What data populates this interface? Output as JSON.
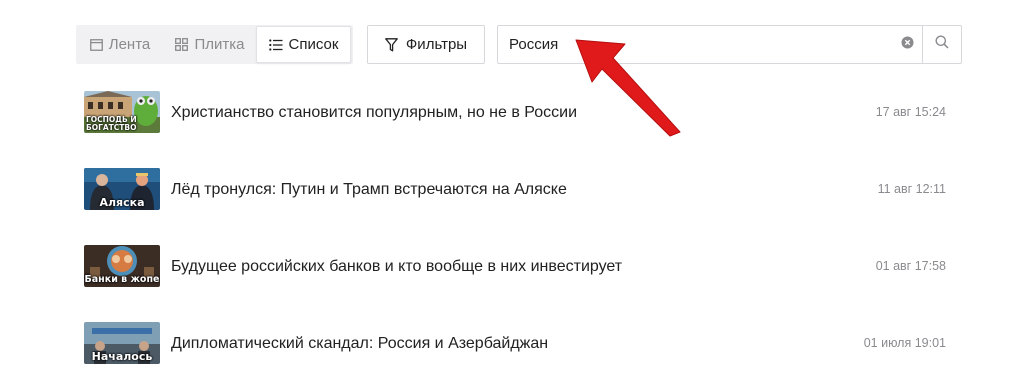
{
  "view_switch": {
    "items": [
      {
        "label": "Лента",
        "icon": "feed-icon",
        "active": false
      },
      {
        "label": "Плитка",
        "icon": "grid-icon",
        "active": false
      },
      {
        "label": "Список",
        "icon": "list-icon",
        "active": true
      }
    ]
  },
  "filters": {
    "label": "Фильтры",
    "icon": "filter-icon"
  },
  "search": {
    "value": "Россия",
    "clear_icon": "clear-icon",
    "search_icon": "search-icon"
  },
  "annotation": {
    "icon": "red-arrow",
    "color": "#e01a1a"
  },
  "articles": [
    {
      "title": "Христианство становится популярным, но не в России",
      "date": "17 авг 15:24",
      "thumb_caption": "Господь и богатство"
    },
    {
      "title": "Лёд тронулся: Путин и Трамп встречаются на Аляске",
      "date": "11 авг 12:11",
      "thumb_caption": "Аляска"
    },
    {
      "title": "Будущее российских банков и кто вообще в них инвестирует",
      "date": "01 авг 17:58",
      "thumb_caption": "Банки в жопе"
    },
    {
      "title": "Дипломатический скандал: Россия и Азербайджан",
      "date": "01 июля 19:01",
      "thumb_caption": "Началось"
    }
  ]
}
